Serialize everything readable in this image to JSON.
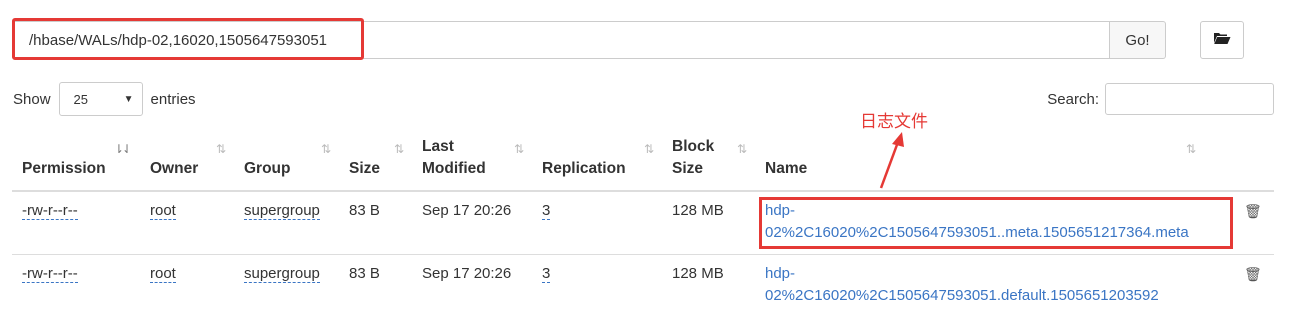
{
  "path_bar": {
    "value": "/hbase/WALs/hdp-02,16020,1505647593051",
    "go_label": "Go!"
  },
  "length_menu": {
    "show_label": "Show",
    "selected": "25",
    "entries_label": "entries"
  },
  "search": {
    "label": "Search:",
    "value": ""
  },
  "table": {
    "headers": {
      "permission": "Permission",
      "owner": "Owner",
      "group": "Group",
      "size": "Size",
      "modified_line1": "Last",
      "modified_line2": "Modified",
      "replication": "Replication",
      "block_line1": "Block",
      "block_line2": "Size",
      "name": "Name"
    },
    "rows": [
      {
        "permission": "-rw-r--r--",
        "owner": "root",
        "group": "supergroup",
        "size": "83 B",
        "modified": "Sep 17 20:26",
        "replication": "3",
        "block_size": "128 MB",
        "name_line1": "hdp-",
        "name_line2": "02%2C16020%2C1505647593051..meta.1505651217364.meta"
      },
      {
        "permission": "-rw-r--r--",
        "owner": "root",
        "group": "supergroup",
        "size": "83 B",
        "modified": "Sep 17 20:26",
        "replication": "3",
        "block_size": "128 MB",
        "name_line1": "hdp-",
        "name_line2": "02%2C16020%2C1505647593051.default.1505651203592"
      }
    ]
  },
  "annotation": {
    "text": "日志文件",
    "color": "#e53935"
  },
  "colors": {
    "link": "#3a75c4",
    "highlight": "#e53935"
  },
  "icons": [
    "folder-open-icon",
    "trash-icon",
    "sort-icon",
    "caret-down-icon"
  ]
}
